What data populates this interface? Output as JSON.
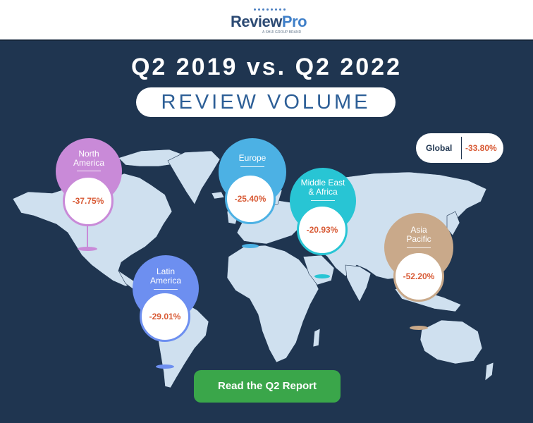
{
  "brand": {
    "name_review": "Review",
    "name_pro": "Pro",
    "tagline": "A SHIJI GROUP BRAND"
  },
  "title": "Q2 2019 vs. Q2 2022",
  "subtitle": "REVIEW VOLUME",
  "global": {
    "label": "Global",
    "value": "-33.80%"
  },
  "regions": {
    "north_america": {
      "name_line1": "North",
      "name_line2": "America",
      "value": "-37.75%",
      "color": "#c98ad8"
    },
    "europe": {
      "name_line1": "Europe",
      "name_line2": "",
      "value": "-25.40%",
      "color": "#4cb1e4"
    },
    "middle_east_africa": {
      "name_line1": "Middle East",
      "name_line2": "& Africa",
      "value": "-20.93%",
      "color": "#28c5d4"
    },
    "latin_america": {
      "name_line1": "Latin",
      "name_line2": "America",
      "value": "-29.01%",
      "color": "#6d8ff0"
    },
    "asia_pacific": {
      "name_line1": "Asia",
      "name_line2": "Pacific",
      "value": "-52.20%",
      "color": "#c9a98a"
    }
  },
  "cta": {
    "label": "Read the Q2 Report",
    "color": "#3aa64a"
  },
  "colors": {
    "background": "#1f3550",
    "land": "#cfe0ef",
    "accent_value": "#d85a35"
  }
}
